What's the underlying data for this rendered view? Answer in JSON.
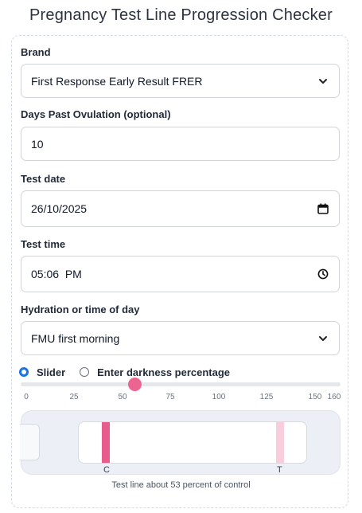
{
  "page": {
    "title": "Pregnancy Test Line Progression Checker"
  },
  "form": {
    "brand": {
      "label": "Brand",
      "value": "First Response Early Result FRER"
    },
    "dpo": {
      "label": "Days Past Ovulation (optional)",
      "value": "10"
    },
    "test_date": {
      "label": "Test date",
      "value": "26/10/2025"
    },
    "test_time": {
      "label": "Test time",
      "value": "05:06  PM"
    },
    "hydration": {
      "label": "Hydration or time of day",
      "value": "FMU first morning"
    }
  },
  "input_mode": {
    "options": [
      {
        "label": "Slider",
        "selected": true
      },
      {
        "label": "Enter darkness percentage",
        "selected": false
      }
    ]
  },
  "slider": {
    "value": 53,
    "min": 0,
    "max": 160,
    "ticks": [
      "0",
      "25",
      "50",
      "75",
      "100",
      "125",
      "150",
      "160"
    ],
    "accent": "#ec6590"
  },
  "preview": {
    "control_label": "C",
    "test_label": "T",
    "control_color": "#e85c8b",
    "test_color": "#f8cedd",
    "caption": "Test line about 53 percent of control"
  }
}
